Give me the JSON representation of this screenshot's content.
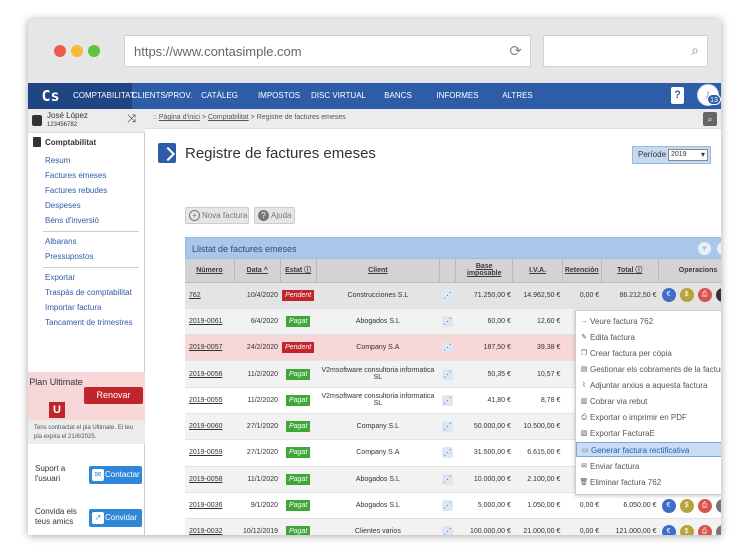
{
  "browser": {
    "url": "https://www.contasimple.com"
  },
  "nav": {
    "logo": "Cs",
    "items": [
      "COMPTABILITAT",
      "CLIENTS/PROV.",
      "CATÀLEG",
      "IMPOSTOS",
      "DISC VIRTUAL",
      "BANCS",
      "INFORMES",
      "ALTRES"
    ],
    "help": "?",
    "user_badge": "13"
  },
  "user": {
    "name": "José López",
    "id": "123456782"
  },
  "breadcrumb": {
    "home": "Pàgina d'inici",
    "section": "Comptabilitat",
    "current": "Registre de factures emeses"
  },
  "sidebar": {
    "section_title": "Comptabilitat",
    "links": [
      "Resum",
      "Factures emeses",
      "Factures rebudes",
      "Despeses",
      "Béns d'inversió"
    ],
    "links2": [
      "Albarans",
      "Pressupostos"
    ],
    "links3": [
      "Exportar",
      "Traspàs de comptabilitat",
      "Importar factura",
      "Tancament de trimestres"
    ],
    "plan": {
      "label": "Plan Ultimate",
      "letter": "U",
      "renew": "Renovar",
      "note": "Tens contractat el pla Ultimate. El teu pla expira el 21/8/2025."
    },
    "support": {
      "text": "Suport a l'usuari",
      "button": "Contactar"
    },
    "invite": {
      "text": "Convida els teus amics",
      "button": "Convidar"
    }
  },
  "main": {
    "title": "Registre de factures emeses",
    "period_label": "Període",
    "period_value": "2019",
    "new_invoice": "Nova factura",
    "help": "Ajuda",
    "list_title": "Llistat de factures emeses",
    "columns": [
      "Número",
      "Data",
      "Estat",
      "Client",
      "",
      "Base imposable",
      "I.V.A.",
      "Retención",
      "Total",
      "Operacions"
    ],
    "rows": [
      {
        "num": "762",
        "date": "10/4/2020",
        "status": "Pendent",
        "client": "Construcciones S.L",
        "base": "71.250,00 €",
        "iva": "14.962,50 €",
        "ret": "0,00 €",
        "total": "86.212,50 €"
      },
      {
        "num": "2019-0061",
        "date": "6/4/2020",
        "status": "Pagat",
        "client": "Abogados S.L",
        "base": "60,00 €",
        "iva": "12,60 €",
        "ret": "0",
        "total": ""
      },
      {
        "num": "2019-0057",
        "date": "24/2/2020",
        "status": "Pendent",
        "client": "Company S.A",
        "base": "187,50 €",
        "iva": "39,38 €",
        "ret": "0",
        "total": ""
      },
      {
        "num": "2019-0056",
        "date": "11/2/2020",
        "status": "Pagat",
        "client": "V2msoftware consultoria informatica SL",
        "base": "50,35 €",
        "iva": "10,57 €",
        "ret": "0",
        "total": ""
      },
      {
        "num": "2019-0055",
        "date": "11/2/2020",
        "status": "Pagat",
        "client": "V2msoftware consultoria informatica SL",
        "base": "41,80 €",
        "iva": "8,78 €",
        "ret": "0",
        "total": ""
      },
      {
        "num": "2019-0060",
        "date": "27/1/2020",
        "status": "Pagat",
        "client": "Company S.L",
        "base": "50.000,00 €",
        "iva": "10.500,00 €",
        "ret": "0",
        "total": ""
      },
      {
        "num": "2019-0059",
        "date": "27/1/2020",
        "status": "Pagat",
        "client": "Company S.A",
        "base": "31.500,00 €",
        "iva": "6.615,00 €",
        "ret": "0",
        "total": ""
      },
      {
        "num": "2019-0058",
        "date": "11/1/2020",
        "status": "Pagat",
        "client": "Abogados S.L",
        "base": "10.000,00 €",
        "iva": "2.100,00 €",
        "ret": "0",
        "total": ""
      },
      {
        "num": "2019-0036",
        "date": "9/1/2020",
        "status": "Pagat",
        "client": "Abogados S.L",
        "base": "5.000,00 €",
        "iva": "1.050,00 €",
        "ret": "0,00 €",
        "total": "6.050,00 €"
      },
      {
        "num": "2019-0032",
        "date": "10/12/2019",
        "status": "Pagat",
        "client": "Clientes varios",
        "base": "100.000,00 €",
        "iva": "21.000,00 €",
        "ret": "0,00 €",
        "total": "121.000,00 €"
      }
    ]
  },
  "menu": {
    "items": [
      "Veure factura 762",
      "Edita factura",
      "Crear factura per còpia",
      "Gestionar els cobraments de la factura",
      "Adjuntar arxius a aquesta factura",
      "Cobrar via rebut",
      "Exportar o imprimir en PDF",
      "Exportar FacturaE",
      "Generar factura rectificativa",
      "Enviar factura",
      "Eliminar factura 762"
    ]
  },
  "colors": {
    "nav": "#2d5da8",
    "pendent": "#c0252b",
    "pagat": "#3fa63a",
    "highlight": "#c9ddf3"
  }
}
